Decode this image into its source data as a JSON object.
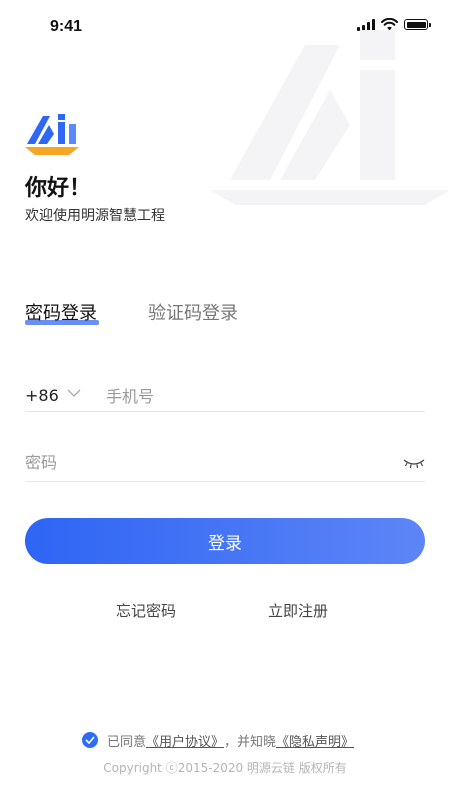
{
  "status_bar": {
    "time": "9:41",
    "icons": [
      "signal-icon",
      "wifi-icon",
      "battery-icon"
    ]
  },
  "colors": {
    "primary": "#2e65f4",
    "primary_light": "#5d85f6",
    "logo_orange": "#f5a623",
    "tab_underline": "#4f7bf3"
  },
  "header": {
    "greeting": "你好！",
    "welcome": "欢迎使用明源智慧工程"
  },
  "tabs": [
    {
      "label": "密码登录",
      "active": true
    },
    {
      "label": "验证码登录",
      "active": false
    }
  ],
  "form": {
    "country_code": "+86",
    "phone_placeholder": "手机号",
    "password_placeholder": "密码"
  },
  "actions": {
    "login": "登录",
    "forgot_password": "忘记密码",
    "register": "立即注册"
  },
  "agreement": {
    "checked": true,
    "prefix": "已同意",
    "user_agreement": "《用户协议》",
    "middle": "，并知晓",
    "privacy_policy": "《隐私声明》"
  },
  "copyright": "Copyright ⓒ2015-2020 明源云链 版权所有"
}
